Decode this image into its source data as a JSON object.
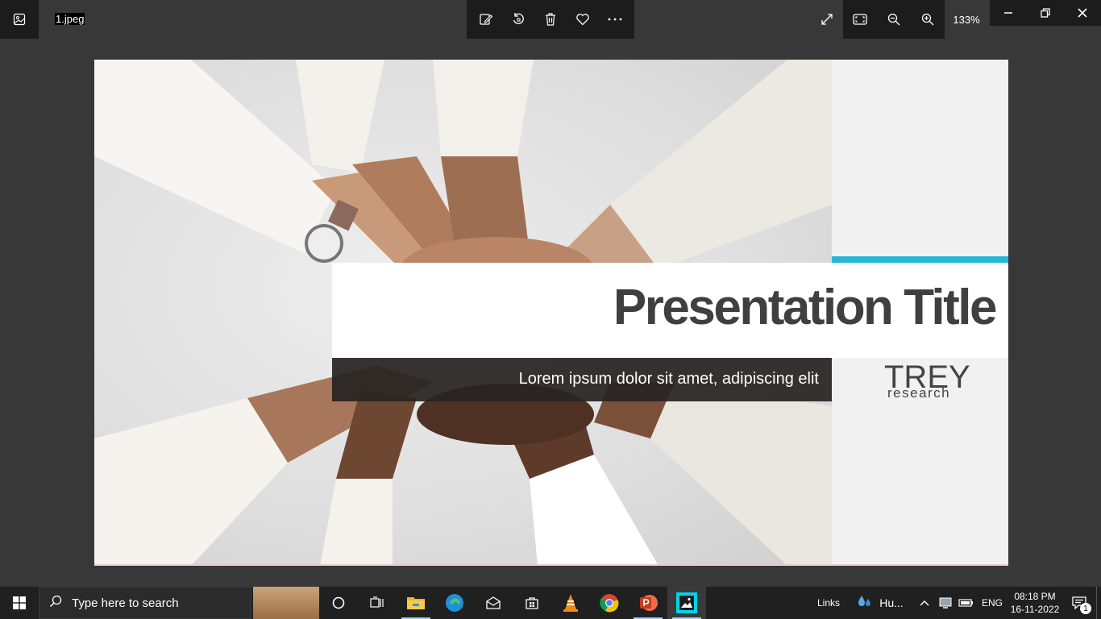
{
  "viewer": {
    "file_name": "1.jpeg",
    "zoom_level": "133%",
    "toolbar_icons": [
      "edit-icon",
      "rotate-icon",
      "delete-icon",
      "favorite-icon",
      "more-icon"
    ],
    "right_icons": [
      "fullscreen-icon",
      "fit-to-window-icon",
      "zoom-out-icon",
      "zoom-in-icon"
    ],
    "window_controls": [
      "minimize-icon",
      "restore-icon",
      "close-icon"
    ]
  },
  "slide": {
    "title": "Presentation Title",
    "subtitle": "Lorem ipsum dolor sit amet, adipiscing elit",
    "logo_main": "TREY",
    "logo_sub": "research",
    "accent_color": "#29b6d6"
  },
  "taskbar": {
    "search_placeholder": "Type here to search",
    "apps": [
      "file-explorer-icon",
      "edge-icon",
      "mail-icon",
      "store-icon",
      "vlc-icon",
      "chrome-icon",
      "powerpoint-icon",
      "photos-icon"
    ],
    "links_label": "Links",
    "weather_label": "Hu...",
    "language": "ENG",
    "time": "08:18 PM",
    "date": "16-11-2022",
    "notification_count": "1"
  }
}
